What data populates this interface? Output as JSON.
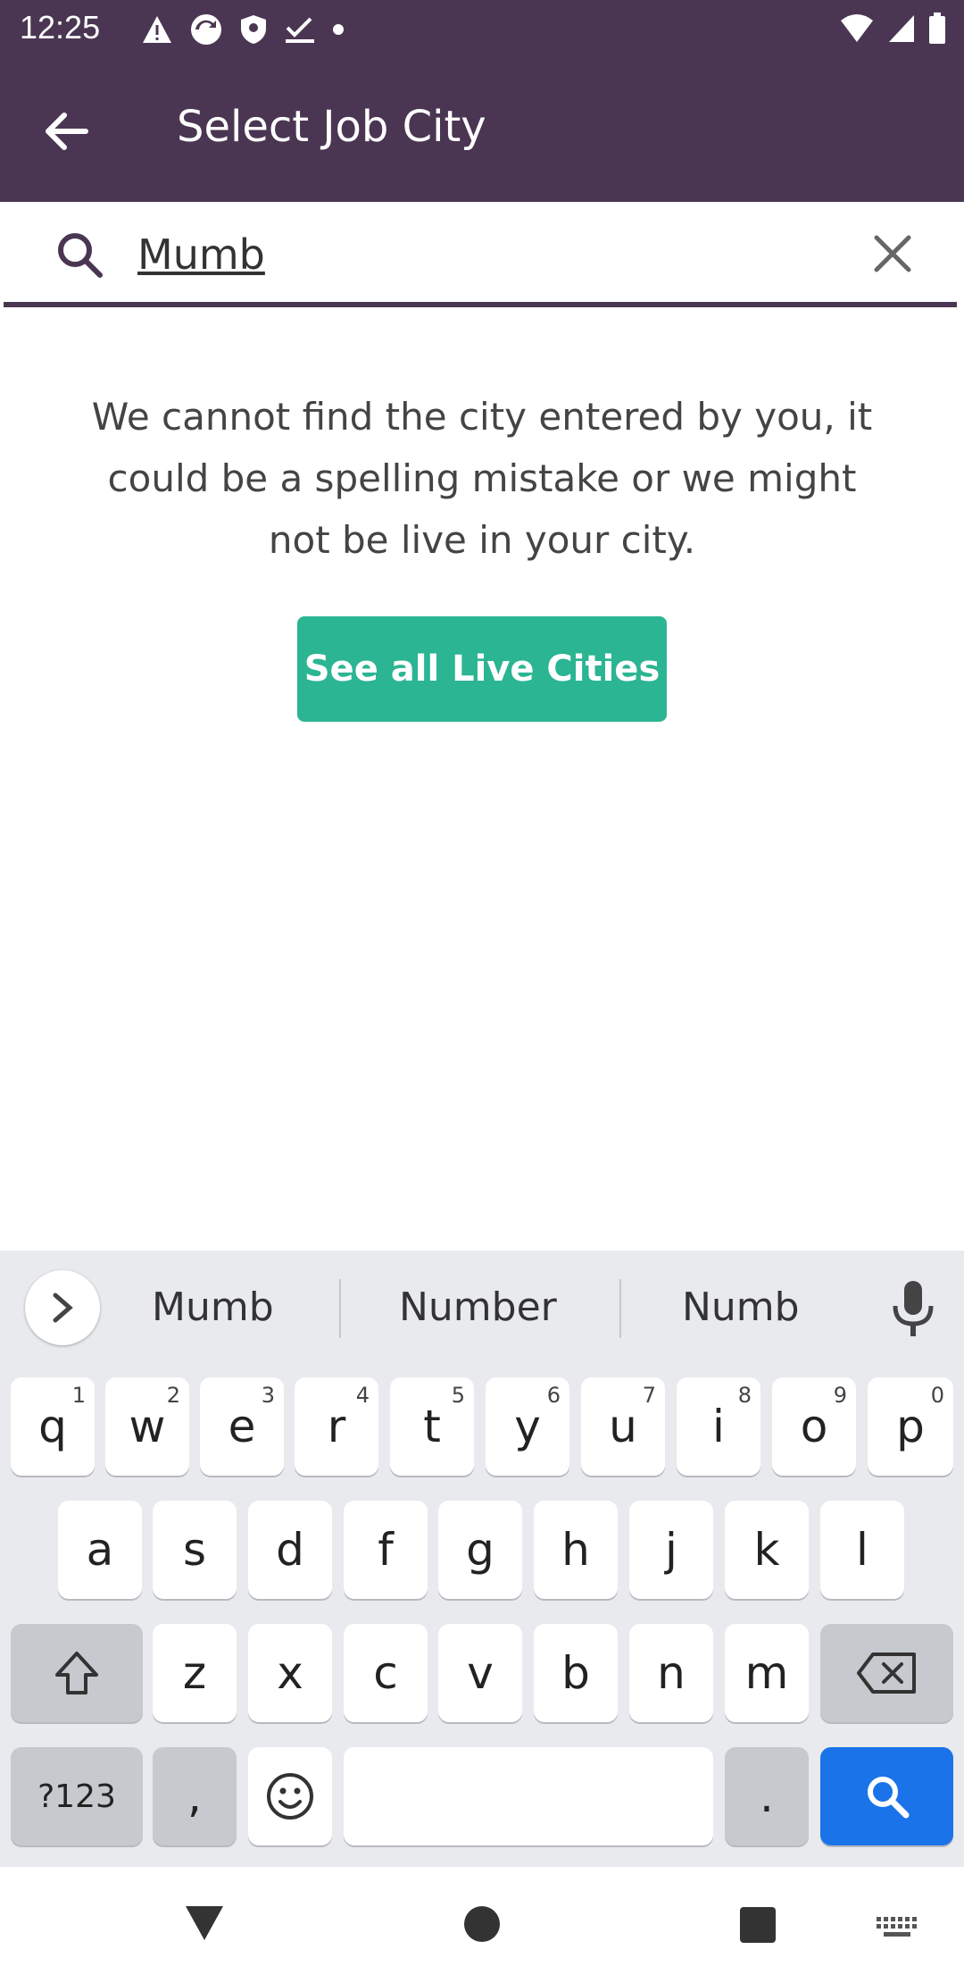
{
  "status_bar": {
    "time": "12:25",
    "left_icons": [
      "warning-icon",
      "sync-icon",
      "shield-icon",
      "check-download-icon",
      "dot-icon"
    ],
    "right_icons": [
      "wifi-icon",
      "signal-icon",
      "battery-icon"
    ]
  },
  "header": {
    "title": "Select Job City",
    "back_icon": "arrow-left-icon"
  },
  "search": {
    "value": "Mumb",
    "search_icon": "search-icon",
    "clear_icon": "close-icon"
  },
  "main": {
    "message": "We cannot find the city entered by you, it could be a spelling mistake or we might not be live in your city.",
    "cta_label": "See all Live Cities"
  },
  "keyboard": {
    "suggestions": [
      "Mumb",
      "Number",
      "Numb"
    ],
    "row1": [
      {
        "key": "q",
        "hint": "1"
      },
      {
        "key": "w",
        "hint": "2"
      },
      {
        "key": "e",
        "hint": "3"
      },
      {
        "key": "r",
        "hint": "4"
      },
      {
        "key": "t",
        "hint": "5"
      },
      {
        "key": "y",
        "hint": "6"
      },
      {
        "key": "u",
        "hint": "7"
      },
      {
        "key": "i",
        "hint": "8"
      },
      {
        "key": "o",
        "hint": "9"
      },
      {
        "key": "p",
        "hint": "0"
      }
    ],
    "row2": [
      "a",
      "s",
      "d",
      "f",
      "g",
      "h",
      "j",
      "k",
      "l"
    ],
    "row3": [
      "z",
      "x",
      "c",
      "v",
      "b",
      "n",
      "m"
    ],
    "symbols_label": "?123",
    "comma": ",",
    "period": ".",
    "accent_color": "#1a73e8"
  },
  "colors": {
    "header_bg": "#4a3652",
    "cta_bg": "#2bb592"
  },
  "nav_bar": {
    "icons": [
      "back-triangle-icon",
      "home-circle-icon",
      "recents-square-icon",
      "keyboard-switch-icon"
    ]
  }
}
